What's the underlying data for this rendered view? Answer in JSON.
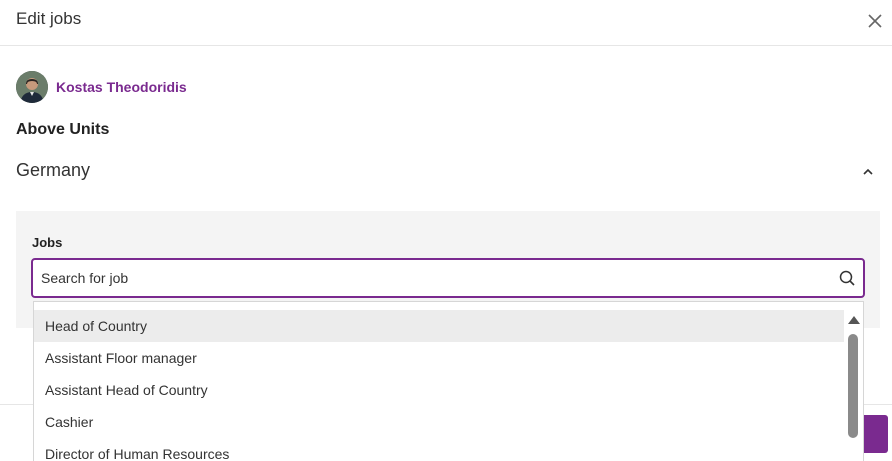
{
  "modal": {
    "title": "Edit jobs",
    "close_icon": "close-icon"
  },
  "user": {
    "name": "Kostas Theodoridis",
    "avatar_icon": "avatar"
  },
  "section": {
    "label": "Above Units"
  },
  "country": {
    "name": "Germany",
    "expanded": true,
    "toggle_icon": "chevron-up-icon"
  },
  "jobs": {
    "label": "Jobs",
    "search_placeholder": "Search for job",
    "search_value": "",
    "search_icon": "search-icon",
    "options": [
      "Head of Country",
      "Assistant Floor manager",
      "Assistant Head of Country",
      "Cashier",
      "Director of Human Resources"
    ],
    "highlighted_index": 0
  },
  "colors": {
    "accent": "#7a2a8f",
    "panel_bg": "#f4f4f4",
    "highlight_bg": "#ececec"
  }
}
